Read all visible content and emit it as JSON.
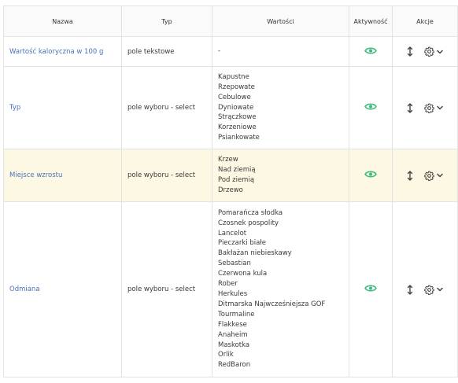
{
  "table": {
    "headers": {
      "name": "Nazwa",
      "type": "Typ",
      "values": "Wartości",
      "active": "Aktywność",
      "actions": "Akcje"
    },
    "rows": [
      {
        "name": "Wartość kaloryczna w 100 g",
        "type": "pole tekstowe",
        "values": [
          "-"
        ],
        "active": true,
        "highlighted": false
      },
      {
        "name": "Typ",
        "type": "pole wyboru - select",
        "values": [
          "Kapustne",
          "Rzepowate",
          "Cebulowe",
          "Dyniowate",
          "Strączkowe",
          "Korzeniowe",
          "Psiankowate"
        ],
        "active": true,
        "highlighted": false
      },
      {
        "name": "Miejsce wzrostu",
        "type": "pole wyboru - select",
        "values": [
          "Krzew",
          "Nad ziemią",
          "Pod ziemią",
          "Drzewo"
        ],
        "active": true,
        "highlighted": true
      },
      {
        "name": "Odmiana",
        "type": "pole wyboru - select",
        "values": [
          "Pomarańcza słodka",
          "Czosnek pospolity",
          "Lancelot",
          "Pieczarki białe",
          "Bakłażan niebieskawy",
          "Sebastian",
          "Czerwona kula",
          "Rober",
          "Herkules",
          "Ditmarska Najwcześniejsza GOF",
          "Tourmaline",
          "Flakkese",
          "Anaheim",
          "Maskotka",
          "Orlik",
          "RedBaron"
        ],
        "active": true,
        "highlighted": false
      }
    ]
  },
  "colors": {
    "link": "#4a72b8",
    "active_eye": "#3dbb7f",
    "row_highlight": "#fcf8e3",
    "border": "#e3e3e3"
  },
  "icons": {
    "active": "eye-icon",
    "sort": "sort-arrows-icon",
    "settings": "gear-icon",
    "dropdown": "chevron-down-icon"
  }
}
